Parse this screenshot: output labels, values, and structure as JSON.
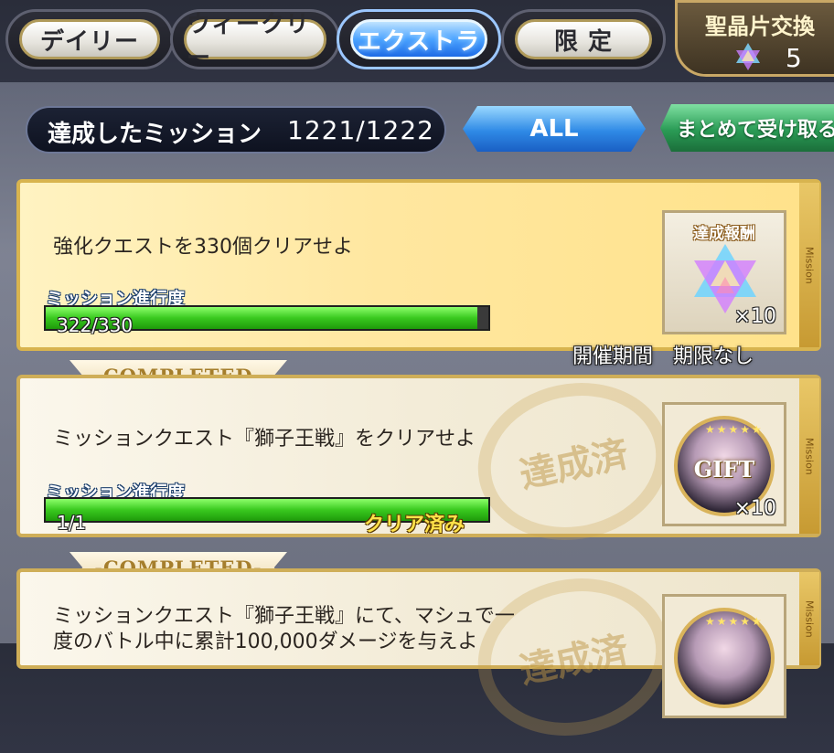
{
  "tabs": [
    {
      "label": "デイリー",
      "active": false
    },
    {
      "label": "ウィークリー",
      "active": false
    },
    {
      "label": "エクストラ",
      "active": true
    },
    {
      "label": "限 定",
      "active": false
    }
  ],
  "shop": {
    "label": "聖晶片交換",
    "count": "5",
    "icon": "saint-quartz-fragment-icon"
  },
  "summary": {
    "label": "達成したミッション",
    "count": "1221/1222"
  },
  "filter": {
    "label": "ALL"
  },
  "claim_all": {
    "label": "まとめて受け取る"
  },
  "missions": [
    {
      "status": "open",
      "description": "強化クエストを330個クリアせよ",
      "progress_label": "ミッション進行度",
      "progress_text": "322/330",
      "progress_fraction": 0.9758,
      "reward_title": "達成報酬",
      "reward_icon": "saint-quartz-fragment-icon",
      "reward_qty": "×10",
      "side_tag": "Mission",
      "period": "開催期間　期限なし"
    },
    {
      "status": "completed",
      "ribbon": "-COMPLETED-",
      "stamp": "達成済",
      "description": "ミッションクエスト『獅子王戦』をクリアせよ",
      "progress_label": "ミッション進行度",
      "progress_text": "1/1",
      "progress_fraction": 1.0,
      "clear_text": "クリア済み",
      "reward_icon": "gift-servant-icon",
      "reward_label": "GIFT",
      "reward_qty": "×10",
      "side_tag": "Mission"
    },
    {
      "status": "completed",
      "ribbon": "-COMPLETED-",
      "description_line1": "ミッションクエスト『獅子王戦』にて、マシュで一",
      "description_line2": "度のバトル中に累計100,000ダメージを与えよ",
      "side_tag": "Mission"
    }
  ],
  "colors": {
    "active_tab": "#2f8ae6",
    "progress_green": "#39c91f",
    "claim_green": "#2a9b55",
    "card_gold_border": "#d8b44f"
  }
}
